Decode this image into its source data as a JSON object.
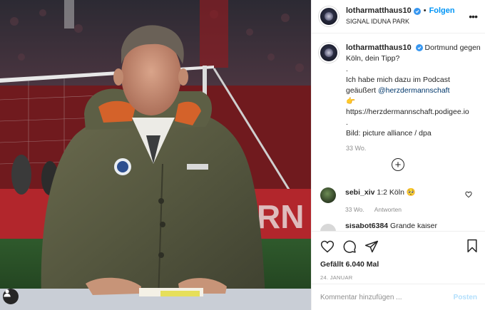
{
  "header": {
    "username": "lotharmatthaus10",
    "follow_label": "Folgen",
    "separator": "•",
    "location": "SIGNAL IDUNA PARK",
    "more_icon": "more-horizontal-icon"
  },
  "caption": {
    "username": "lotharmatthaus10",
    "lines": [
      "Dortmund gegen",
      "Köln, dein Tipp?",
      ".",
      "Ich habe mich dazu im Podcast",
      "geäußert",
      "@herzdermannschaft",
      "https://herzdermannschaft.podigee.io",
      ".",
      "Bild: picture alliance / dpa"
    ],
    "emoji": "👉",
    "timestamp": "33 Wo."
  },
  "comments": [
    {
      "username": "sebi_xiv",
      "text": "1:2 Köln",
      "emoji": "🥺",
      "meta_time": "33 Wo.",
      "meta_reply": "Antworten"
    },
    {
      "username": "sisabot6384",
      "text": "Grande kaiser"
    }
  ],
  "actions": {
    "likes": "Gefällt 6.040 Mal",
    "date": "24. JANUAR"
  },
  "add_comment": {
    "placeholder": "Kommentar hinzufügen ...",
    "post_label": "Posten"
  },
  "colors": {
    "accent": "#0095f6",
    "verified": "#3897f0",
    "secondary_text": "#8e8e8e",
    "mention": "#00376b",
    "post_disabled": "#b2dffc"
  }
}
